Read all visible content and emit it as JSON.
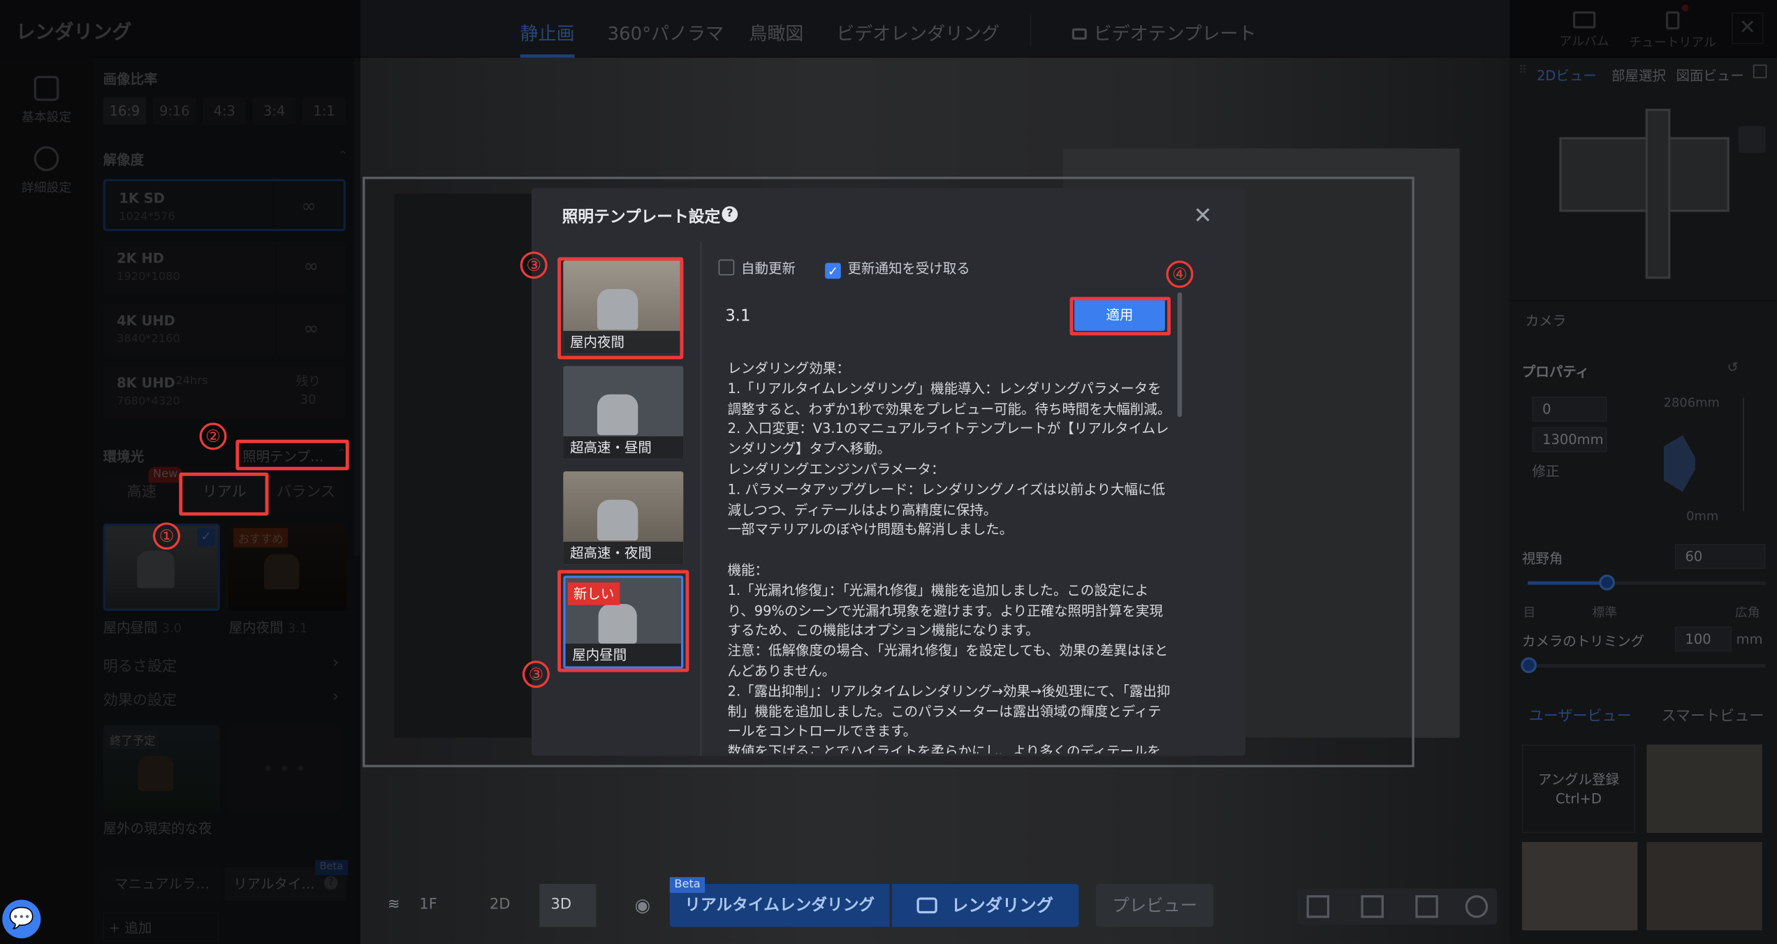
{
  "app": {
    "title": "レンダリング",
    "close": "✕"
  },
  "tabs": [
    "静止画",
    "360°パノラマ",
    "鳥瞰図",
    "ビデオレンダリング",
    "ビデオテンプレート"
  ],
  "top_buttons": {
    "album": "アルバム",
    "tutorial": "チュートリアル"
  },
  "nav": {
    "basic": "基本設定",
    "detail": "詳細設定"
  },
  "left": {
    "aspect_title": "画像比率",
    "ratios": [
      "16:9",
      "9:16",
      "4:3",
      "3:4",
      "1:1"
    ],
    "resolution_title": "解像度",
    "resolutions": [
      {
        "name": "1K SD",
        "dims": "1024*576",
        "icon": "∞"
      },
      {
        "name": "2K HD",
        "dims": "1920*1080",
        "icon": "∞"
      },
      {
        "name": "4K UHD",
        "dims": "3840*2160",
        "icon": "∞"
      },
      {
        "name": "8K UHD",
        "tag": "24hrs",
        "dims": "7680*4320",
        "remain_label": "残り",
        "remain": "30"
      }
    ],
    "env_title": "環境光",
    "template_link": "照明テンプ…",
    "light_modes": [
      "高速",
      "リアル",
      "バランス"
    ],
    "new_badge": "New",
    "presets": [
      {
        "name": "屋内昼間",
        "ver": "3.0"
      },
      {
        "name": "屋内夜間",
        "ver": "3.1",
        "badge": "おすすめ"
      }
    ],
    "brightness": "明るさ設定",
    "effect": "効果の設定",
    "outdoor_badge": "終了予定",
    "outdoor_name": "屋外の現実的な夜",
    "manual": "マニュアルラ…",
    "realtime": "リアルタイ…",
    "beta": "Beta",
    "add": "+ 追加"
  },
  "bottom": {
    "floor": "1F",
    "mode2d": "2D",
    "mode3d": "3D",
    "realtime": "リアルタイムレンダリング",
    "render": "レンダリング",
    "preview": "プレビュー",
    "beta": "Beta"
  },
  "right": {
    "view_tabs": [
      "2Dビュー",
      "部屋選択",
      "図面ビュー"
    ],
    "camera": "カメラ",
    "property": "プロパティ",
    "val0": "0",
    "val1300": "1300mm",
    "dim2806": "2806mm",
    "dim0": "0mm",
    "fix": "修正",
    "fov_label": "視野角",
    "fov": "60",
    "fov_marks": [
      "目",
      "標準",
      "広角"
    ],
    "trim_label": "カメラのトリミング",
    "trim": "100",
    "trim_unit": "mm",
    "user_view": "ユーザービュー",
    "smart_view": "スマートビュー",
    "angle_reg": "アングル登録",
    "angle_key": "Ctrl+D"
  },
  "modal": {
    "title": "照明テンプレート設定",
    "help": "?",
    "close": "✕",
    "templates": [
      {
        "name": "屋内夜間"
      },
      {
        "name": "超高速・昼間"
      },
      {
        "name": "超高速・夜間"
      },
      {
        "name": "屋内昼間",
        "new": "新しい"
      }
    ],
    "auto_update": "自動更新",
    "notify": "更新通知を受け取る",
    "version": "3.1",
    "apply": "適用",
    "notes": "レンダリング効果：\n1.「リアルタイムレンダリング」機能導入：レンダリングパラメータを調整すると、わずか1秒で効果をプレビュー可能。待ち時間を大幅削減。\n2. 入口変更：V3.1のマニュアルライトテンプレートが【リアルタイムレンダリング】タブへ移動。\nレンダリングエンジンパラメータ：\n1. パラメータアップグレード：レンダリングノイズは以前より大幅に低減しつつ、ディテールはより高精度に保持。\n一部マテリアルのぼやけ問題も解消しました。\n\n機能：\n1.「光漏れ修復」：「光漏れ修復」機能を追加しました。この設定により、99%のシーンで光漏れ現象を避けます。より正確な照明計算を実現するため、この機能はオプション機能になります。\n注意：低解像度の場合、「光漏れ修復」を設定しても、効果の差異はほとんどありません。\n2.「露出抑制」：リアルタイムレンダリング→効果→後処理にて、「露出抑制」機能を追加しました。このパラメーターは露出領域の輝度とディテールをコントロールできます。\n数値を下げることでハイライトを柔らかにし、より多くのディテールを"
  },
  "annotations": [
    "①",
    "②",
    "③",
    "③",
    "④"
  ]
}
